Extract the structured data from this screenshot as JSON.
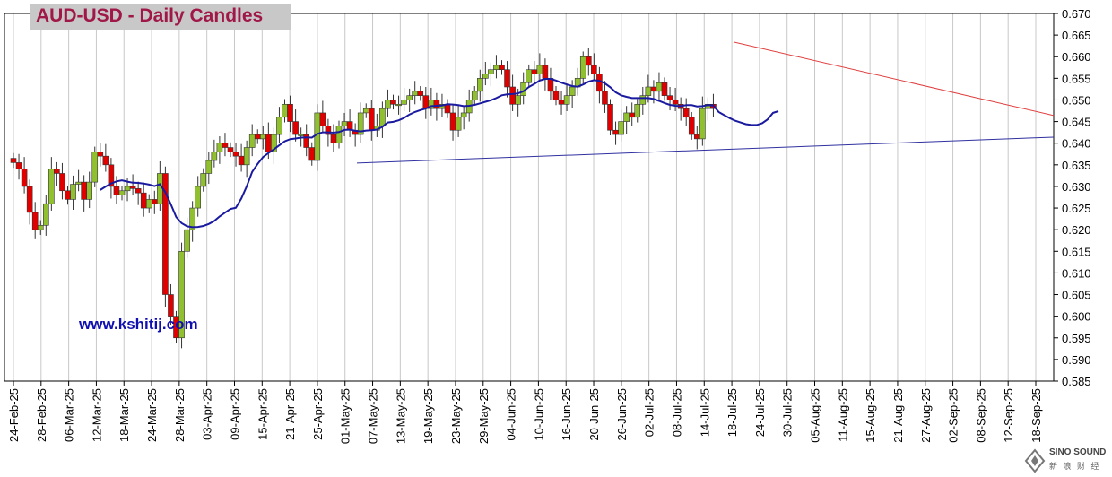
{
  "title": "AUD-USD - Daily Candles",
  "website": "www.kshitij.com",
  "logo": {
    "name": "SINO SOUND",
    "sub": "新 浪 财 经"
  },
  "colors": {
    "up": "#90c030",
    "down": "#e00000",
    "ma": "#1a1aa0",
    "resistance": "#e04040",
    "support": "#3030a0",
    "grid": "#c8c8c8"
  },
  "chart_data": {
    "type": "candlestick",
    "title": "AUD-USD - Daily Candles",
    "ylim": [
      0.585,
      0.67
    ],
    "y_ticks": [
      "0.670",
      "0.665",
      "0.660",
      "0.655",
      "0.650",
      "0.645",
      "0.640",
      "0.635",
      "0.630",
      "0.625",
      "0.620",
      "0.615",
      "0.610",
      "0.605",
      "0.600",
      "0.595",
      "0.590",
      "0.585"
    ],
    "x_ticks": [
      "24-Feb-25",
      "28-Feb-25",
      "06-Mar-25",
      "12-Mar-25",
      "18-Mar-25",
      "24-Mar-25",
      "28-Mar-25",
      "03-Apr-25",
      "09-Apr-25",
      "15-Apr-25",
      "21-Apr-25",
      "25-Apr-25",
      "01-May-25",
      "07-May-25",
      "13-May-25",
      "19-May-25",
      "23-May-25",
      "29-May-25",
      "04-Jun-25",
      "10-Jun-25",
      "16-Jun-25",
      "20-Jun-25",
      "26-Jun-25",
      "02-Jul-25",
      "08-Jul-25",
      "14-Jul-25",
      "18-Jul-25",
      "24-Jul-25",
      "30-Jul-25",
      "05-Aug-25",
      "11-Aug-25",
      "15-Aug-25",
      "21-Aug-25",
      "27-Aug-25",
      "02-Sep-25",
      "08-Sep-25",
      "12-Sep-25",
      "18-Sep-25"
    ],
    "grid": "vertical",
    "candles_close": [
      0.6355,
      0.634,
      0.63,
      0.624,
      0.62,
      0.621,
      0.626,
      0.634,
      0.633,
      0.629,
      0.627,
      0.6305,
      0.631,
      0.627,
      0.631,
      0.638,
      0.637,
      0.635,
      0.63,
      0.628,
      0.629,
      0.63,
      0.6295,
      0.6285,
      0.625,
      0.627,
      0.626,
      0.633,
      0.605,
      0.6,
      0.595,
      0.615,
      0.62,
      0.625,
      0.63,
      0.633,
      0.636,
      0.638,
      0.64,
      0.639,
      0.638,
      0.637,
      0.635,
      0.639,
      0.642,
      0.641,
      0.642,
      0.638,
      0.642,
      0.646,
      0.649,
      0.645,
      0.642,
      0.642,
      0.639,
      0.636,
      0.647,
      0.644,
      0.642,
      0.64,
      0.644,
      0.645,
      0.643,
      0.642,
      0.647,
      0.648,
      0.643,
      0.644,
      0.648,
      0.65,
      0.649,
      0.649,
      0.65,
      0.651,
      0.652,
      0.651,
      0.648,
      0.65,
      0.648,
      0.649,
      0.647,
      0.643,
      0.646,
      0.647,
      0.65,
      0.652,
      0.655,
      0.656,
      0.657,
      0.658,
      0.657,
      0.653,
      0.649,
      0.651,
      0.654,
      0.657,
      0.656,
      0.658,
      0.655,
      0.652,
      0.65,
      0.649,
      0.651,
      0.653,
      0.655,
      0.66,
      0.658,
      0.656,
      0.652,
      0.649,
      0.643,
      0.642,
      0.645,
      0.647,
      0.646,
      0.649,
      0.651,
      0.653,
      0.652,
      0.654,
      0.651,
      0.65,
      0.649,
      0.648,
      0.646,
      0.642,
      0.641,
      0.648,
      0.649,
      0.648
    ],
    "moving_average": "blue line",
    "trendlines": [
      "resistance (red, descending)",
      "support (blue, ascending)"
    ]
  }
}
